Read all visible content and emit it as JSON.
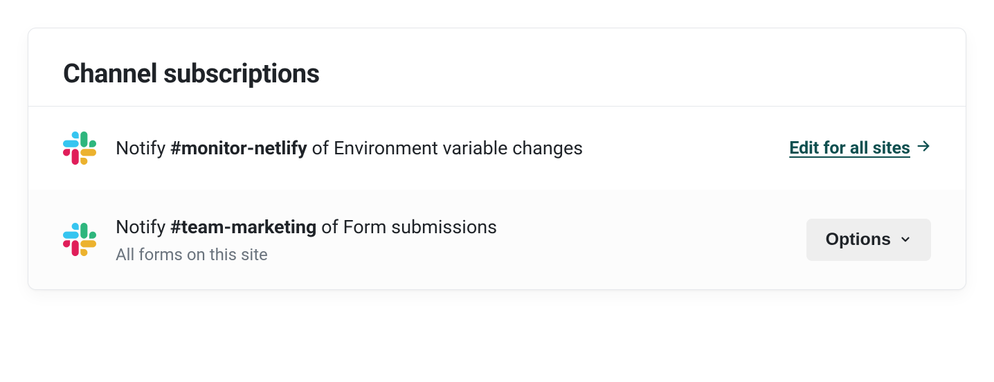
{
  "card": {
    "title": "Channel subscriptions"
  },
  "subscriptions": [
    {
      "prefix": "Notify ",
      "channel": "#monitor-netlify",
      "suffix": " of Environment variable changes",
      "subtitle": "",
      "action_type": "link",
      "action_label": "Edit for all sites"
    },
    {
      "prefix": "Notify ",
      "channel": "#team-marketing",
      "suffix": " of Form submissions",
      "subtitle": "All forms on this site",
      "action_type": "button",
      "action_label": "Options"
    }
  ],
  "colors": {
    "link": "#0e4f4f",
    "text": "#1f2328",
    "muted": "#6a737d",
    "border": "#e5e7eb",
    "button_bg": "#eeeeee"
  }
}
